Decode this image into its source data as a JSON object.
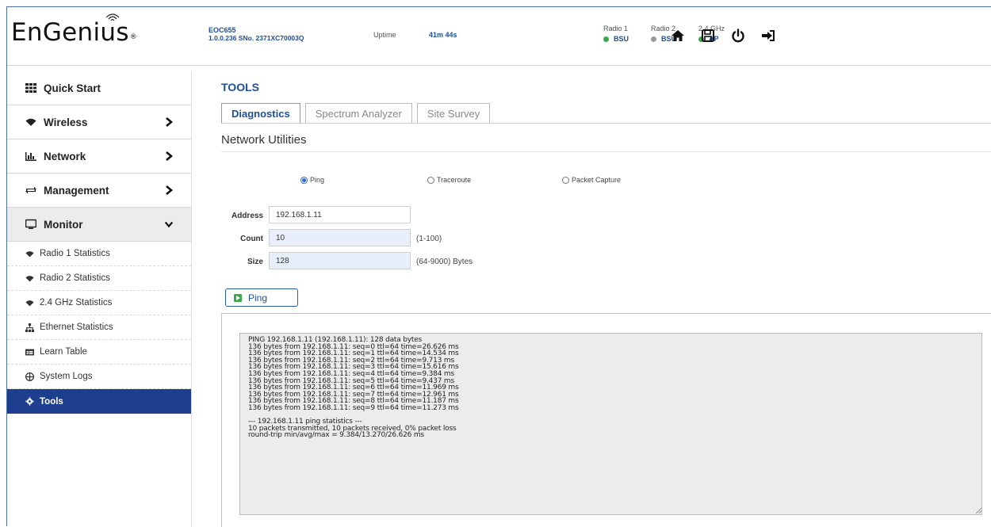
{
  "header": {
    "logo": "EnGenius",
    "model": "EOC655",
    "firmware": "1.0.0.236 SNo. 2371XC70003Q",
    "uptime_label": "Uptime",
    "uptime_value": "41m 44s",
    "radios": [
      {
        "label": "Radio 1",
        "status": "BSU",
        "color": "#3aa94a"
      },
      {
        "label": "Radio 2",
        "status": "BSU",
        "color": "#9a9a9a"
      },
      {
        "label": "2.4 GHz",
        "status": "AP",
        "color": "#3aa94a"
      }
    ],
    "icons": [
      "home-icon",
      "save-icon",
      "power-icon",
      "logout-icon"
    ]
  },
  "sidebar": {
    "items": [
      {
        "label": "Quick Start",
        "icon": "grid-icon"
      },
      {
        "label": "Wireless",
        "icon": "wifi-icon"
      },
      {
        "label": "Network",
        "icon": "chart-icon"
      },
      {
        "label": "Management",
        "icon": "exchange-icon"
      },
      {
        "label": "Monitor",
        "icon": "monitor-icon"
      }
    ],
    "monitor_items": [
      {
        "label": "Radio 1 Statistics",
        "icon": "wifi-icon"
      },
      {
        "label": "Radio 2 Statistics",
        "icon": "wifi-icon"
      },
      {
        "label": "2.4 GHz Statistics",
        "icon": "wifi-icon"
      },
      {
        "label": "Ethernet Statistics",
        "icon": "sitemap-icon"
      },
      {
        "label": "Learn Table",
        "icon": "table-icon"
      },
      {
        "label": "System Logs",
        "icon": "globe-icon"
      },
      {
        "label": "Tools",
        "icon": "gear-icon"
      }
    ]
  },
  "main": {
    "title": "TOOLS",
    "tabs": [
      "Diagnostics",
      "Spectrum Analyzer",
      "Site Survey"
    ],
    "active_tab": "Diagnostics",
    "section_title": "Network Utilities",
    "utilities": [
      "Ping",
      "Traceroute",
      "Packet Capture"
    ],
    "selected_utility": "Ping",
    "fields": {
      "address": {
        "label": "Address",
        "value": "192.168.1.11"
      },
      "count": {
        "label": "Count",
        "value": "10",
        "hint": "(1-100)"
      },
      "size": {
        "label": "Size",
        "value": "128",
        "hint": "(64-9000) Bytes"
      }
    },
    "ping_button": "Ping",
    "output": "PING 192.168.1.11 (192.168.1.11): 128 data bytes\n136 bytes from 192.168.1.11: seq=0 ttl=64 time=26.626 ms\n136 bytes from 192.168.1.11: seq=1 ttl=64 time=14.534 ms\n136 bytes from 192.168.1.11: seq=2 ttl=64 time=9.713 ms\n136 bytes from 192.168.1.11: seq=3 ttl=64 time=15.616 ms\n136 bytes from 192.168.1.11: seq=4 ttl=64 time=9.384 ms\n136 bytes from 192.168.1.11: seq=5 ttl=64 time=9.437 ms\n136 bytes from 192.168.1.11: seq=6 ttl=64 time=11.969 ms\n136 bytes from 192.168.1.11: seq=7 ttl=64 time=12.961 ms\n136 bytes from 192.168.1.11: seq=8 ttl=64 time=11.187 ms\n136 bytes from 192.168.1.11: seq=9 ttl=64 time=11.273 ms\n\n--- 192.168.1.11 ping statistics ---\n10 packets transmitted, 10 packets received, 0% packet loss\nround-trip min/avg/max = 9.384/13.270/26.626 ms"
  }
}
